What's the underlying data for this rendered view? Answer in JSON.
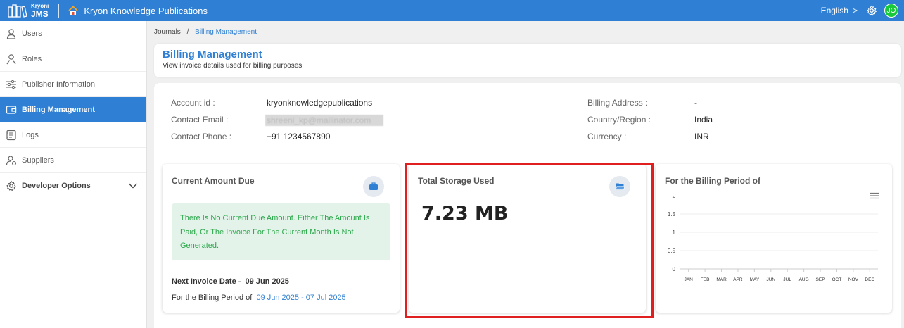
{
  "topbar": {
    "logo_line1": "Kryoni",
    "logo_line2": "JMS",
    "app_title": "Kryon Knowledge Publications",
    "language": "English",
    "language_chevron": ">",
    "avatar_initials": "JO"
  },
  "sidebar": {
    "items": [
      {
        "label": "Users",
        "icon": "user-icon"
      },
      {
        "label": "Roles",
        "icon": "roles-icon"
      },
      {
        "label": "Publisher Information",
        "icon": "sliders-icon"
      },
      {
        "label": "Billing Management",
        "icon": "wallet-icon",
        "active": true
      },
      {
        "label": "Logs",
        "icon": "logs-icon"
      },
      {
        "label": "Suppliers",
        "icon": "supplier-icon"
      },
      {
        "label": "Developer Options",
        "icon": "gear-icon",
        "expandable": true
      }
    ]
  },
  "breadcrumb": {
    "root": "Journals",
    "separator": "/",
    "current": "Billing Management"
  },
  "header": {
    "title": "Billing Management",
    "subtitle": "View invoice details used for billing purposes"
  },
  "account": {
    "account_id_label": "Account id :",
    "account_id_value": "kryonknowledgepublications",
    "contact_email_label": "Contact Email :",
    "contact_email_value": "shreeni_kp@mailinator.com",
    "contact_phone_label": "Contact Phone :",
    "contact_phone_value": "+91 1234567890",
    "billing_address_label": "Billing Address :",
    "billing_address_value": "-",
    "country_label": "Country/Region :",
    "country_value": "India",
    "currency_label": "Currency :",
    "currency_value": "INR"
  },
  "current_due": {
    "title": "Current Amount Due",
    "message": "There Is No Current Due Amount. Either The Amount Is Paid, Or The Invoice For The Current Month Is Not Generated.",
    "next_invoice_label": "Next Invoice Date -",
    "next_invoice_date": "09 Jun 2025",
    "period_label": "For the Billing Period of",
    "period_value": "09 Jun 2025 - 07 Jul 2025"
  },
  "storage": {
    "title": "Total Storage Used",
    "value": "7.23 MB"
  },
  "billing_chart": {
    "title": "For the Billing Period of"
  },
  "chart_data": {
    "type": "line",
    "categories": [
      "JAN",
      "FEB",
      "MAR",
      "APR",
      "MAY",
      "JUN",
      "JUL",
      "AUG",
      "SEP",
      "OCT",
      "NOV",
      "DEC"
    ],
    "series": [],
    "y_ticks": [
      "2",
      "1.5",
      "1",
      "0.5",
      "0"
    ],
    "ylim": [
      0,
      2
    ],
    "grid": true
  },
  "colors": {
    "primary": "#2f80d4",
    "success": "#2aa84a",
    "highlight": "#e02020",
    "avatar": "#18c93a"
  }
}
